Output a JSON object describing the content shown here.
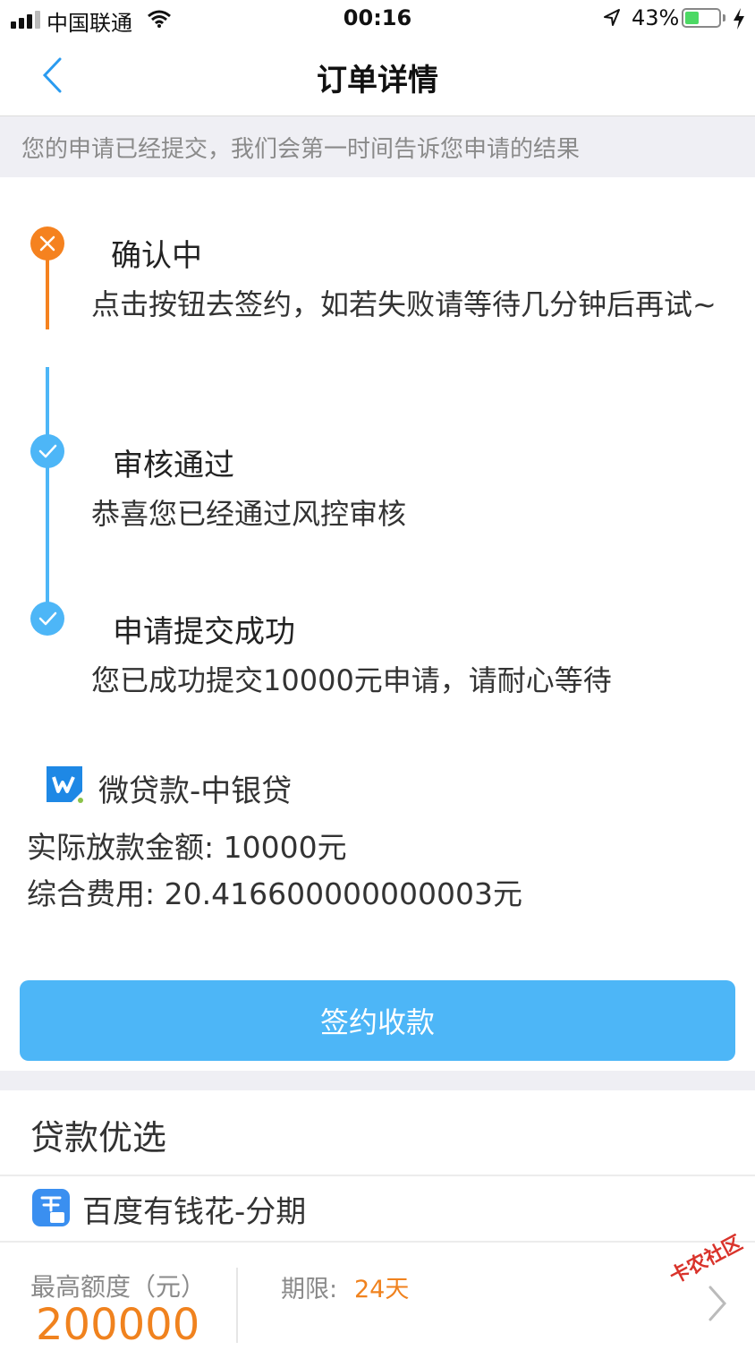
{
  "status_bar": {
    "carrier": "中国联通",
    "time": "00:16",
    "battery_percent": "43%",
    "battery_level": 0.43,
    "icons": [
      "signal-icon",
      "wifi-icon",
      "location-arrow-icon",
      "battery-icon",
      "charging-bolt-icon"
    ]
  },
  "nav": {
    "title": "订单详情",
    "back_icon": "chevron-left-icon"
  },
  "notice": "您的申请已经提交，我们会第一时间告诉您申请的结果",
  "timeline": {
    "steps": [
      {
        "title": "确认中",
        "desc": "点击按钮去签约，如若失败请等待几分钟后再试~",
        "status": "pending",
        "icon": "close-x-icon",
        "color": "#f5821f"
      },
      {
        "title": "审核通过",
        "desc": "恭喜您已经通过风控审核",
        "status": "done",
        "icon": "check-icon",
        "color": "#4db6f7"
      },
      {
        "title": "申请提交成功",
        "desc": "您已成功提交10000元申请，请耐心等待",
        "status": "done",
        "icon": "check-icon",
        "color": "#4db6f7"
      }
    ]
  },
  "product": {
    "name": "微贷款-中银贷",
    "amount_line": "实际放款金额: 10000元",
    "fee_line": "综合费用: 20.416600000000003元"
  },
  "sign_button": "签约收款",
  "recommend": {
    "title": "贷款优选",
    "loan_name": "百度有钱花-分期",
    "quota_label": "最高额度（元）",
    "quota_value": "200000",
    "term_label": "期限:",
    "term_value": "24天"
  },
  "watermark": "卡农社区",
  "colors": {
    "accent_blue": "#4db6f7",
    "accent_orange": "#f5821f",
    "notice_bg": "#efeff4"
  }
}
